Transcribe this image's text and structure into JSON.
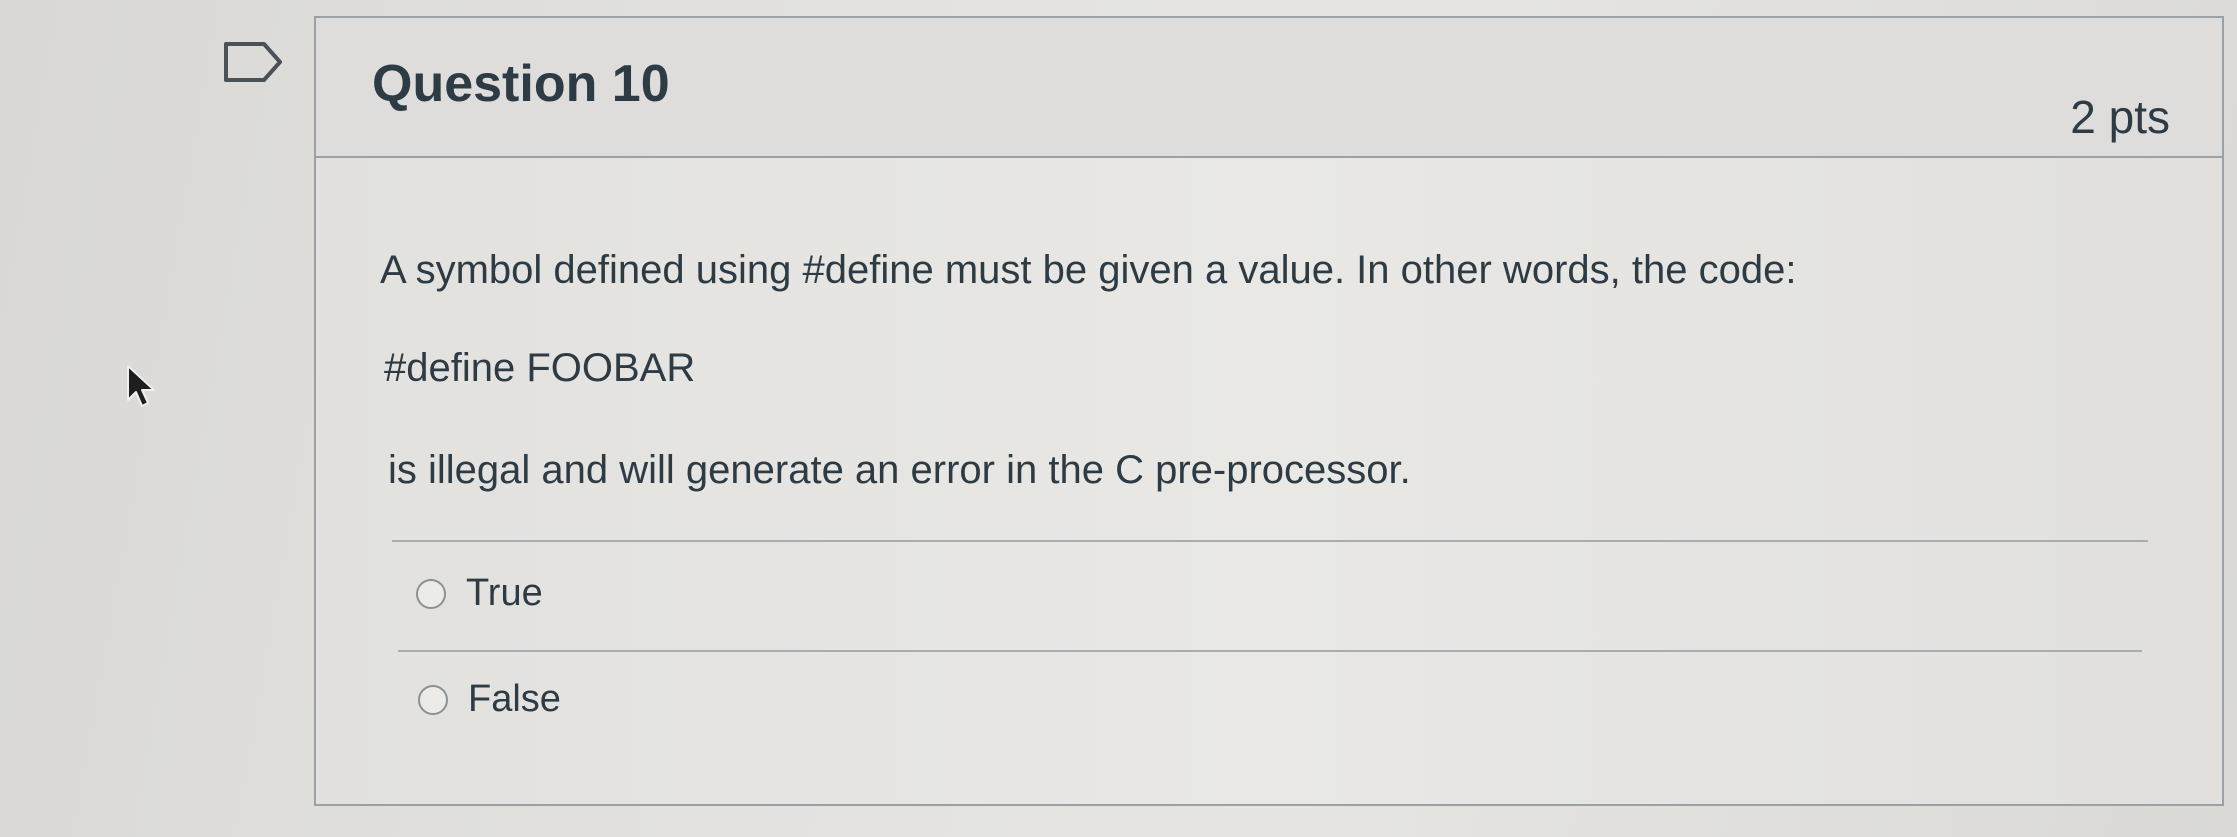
{
  "question": {
    "title": "Question 10",
    "points": "2 pts",
    "text_lines": [
      "A symbol defined using #define must be given a value.  In other words, the code:",
      "#define FOOBAR",
      "is illegal and will generate an error in the C pre-processor."
    ],
    "answers": [
      {
        "label": "True",
        "selected": false
      },
      {
        "label": "False",
        "selected": false
      }
    ]
  },
  "icons": {
    "flag": "flag-bookmark-icon",
    "cursor": "mouse-pointer-icon"
  },
  "colors": {
    "text": "#2d3b45",
    "border": "#9aa0a4",
    "background": "#dcdcda"
  }
}
